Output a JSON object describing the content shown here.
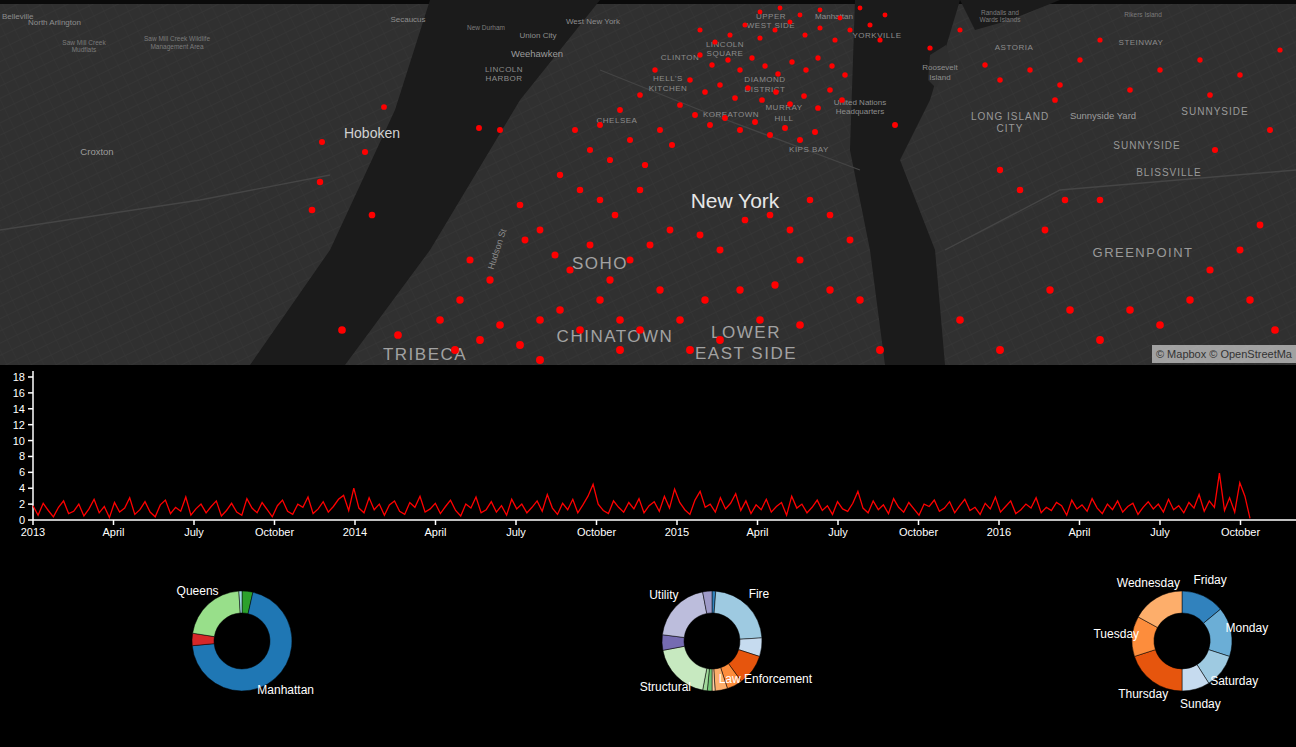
{
  "map": {
    "labels": [
      {
        "text": "Belleville"
      },
      {
        "text": "North Arlington"
      },
      {
        "text": "Secaucus"
      },
      {
        "text": "New Durham"
      },
      {
        "text": "West New York"
      },
      {
        "text": "Union City"
      },
      {
        "text": "Weehawken"
      },
      {
        "text": "LINCOLN"
      },
      {
        "text": "HARBOR"
      },
      {
        "text": "Saw Mill Creek"
      },
      {
        "text": "Mudflats"
      },
      {
        "text": "Saw Mill Creek Wildlife"
      },
      {
        "text": "Management Area"
      },
      {
        "text": "Hoboken"
      },
      {
        "text": "Croxton"
      },
      {
        "text": "CLINTON"
      },
      {
        "text": "HELL'S"
      },
      {
        "text": "KITCHEN"
      },
      {
        "text": "LINCOLN"
      },
      {
        "text": "SQUARE"
      },
      {
        "text": "UPPER"
      },
      {
        "text": "WEST SIDE"
      },
      {
        "text": "Manhattan"
      },
      {
        "text": "YORKVILLE"
      },
      {
        "text": "DIAMOND"
      },
      {
        "text": "DISTRICT"
      },
      {
        "text": "CHELSEA"
      },
      {
        "text": "KOREATOWN"
      },
      {
        "text": "MURRAY"
      },
      {
        "text": "HILL"
      },
      {
        "text": "United Nations"
      },
      {
        "text": "Headquarters"
      },
      {
        "text": "Roosevelt"
      },
      {
        "text": "Island"
      },
      {
        "text": "Randalls and"
      },
      {
        "text": "Wards Islands"
      },
      {
        "text": "Rikers Island"
      },
      {
        "text": "ASTORIA"
      },
      {
        "text": "STEINWAY"
      },
      {
        "text": "KIPS BAY"
      },
      {
        "text": "LONG ISLAND"
      },
      {
        "text": "CITY"
      },
      {
        "text": "Sunnyside Yard"
      },
      {
        "text": "SUNNYSIDE"
      },
      {
        "text": "SUNNYSIDE"
      },
      {
        "text": "BLISSVILLE"
      },
      {
        "text": "GREENPOINT"
      },
      {
        "text": "New York"
      },
      {
        "text": "SOHO"
      },
      {
        "text": "CHINATOWN"
      },
      {
        "text": "LOWER"
      },
      {
        "text": "EAST SIDE"
      },
      {
        "text": "TRIBECA"
      },
      {
        "text": "Hudson St"
      }
    ],
    "incidents": [
      [
        700,
        30
      ],
      [
        715,
        42
      ],
      [
        730,
        35
      ],
      [
        745,
        25
      ],
      [
        760,
        38
      ],
      [
        775,
        30
      ],
      [
        790,
        22
      ],
      [
        805,
        35
      ],
      [
        820,
        28
      ],
      [
        835,
        40
      ],
      [
        850,
        30
      ],
      [
        700,
        55
      ],
      [
        712,
        65
      ],
      [
        728,
        60
      ],
      [
        740,
        70
      ],
      [
        752,
        58
      ],
      [
        765,
        66
      ],
      [
        778,
        74
      ],
      [
        792,
        62
      ],
      [
        806,
        70
      ],
      [
        818,
        58
      ],
      [
        832,
        66
      ],
      [
        845,
        75
      ],
      [
        690,
        80
      ],
      [
        705,
        92
      ],
      [
        720,
        85
      ],
      [
        735,
        98
      ],
      [
        748,
        88
      ],
      [
        762,
        100
      ],
      [
        776,
        92
      ],
      [
        790,
        104
      ],
      [
        804,
        96
      ],
      [
        818,
        108
      ],
      [
        830,
        90
      ],
      [
        842,
        100
      ],
      [
        680,
        105
      ],
      [
        695,
        115
      ],
      [
        710,
        125
      ],
      [
        725,
        118
      ],
      [
        740,
        130
      ],
      [
        755,
        122
      ],
      [
        770,
        135
      ],
      [
        785,
        128
      ],
      [
        800,
        140
      ],
      [
        815,
        132
      ],
      [
        760,
        12
      ],
      [
        780,
        8
      ],
      [
        800,
        15
      ],
      [
        820,
        10
      ],
      [
        840,
        18
      ],
      [
        860,
        8
      ],
      [
        870,
        25
      ],
      [
        880,
        40
      ],
      [
        885,
        15
      ],
      [
        655,
        70
      ],
      [
        640,
        95
      ],
      [
        660,
        130
      ],
      [
        672,
        145
      ],
      [
        620,
        110
      ],
      [
        600,
        125
      ],
      [
        575,
        130
      ],
      [
        590,
        150
      ],
      [
        610,
        160
      ],
      [
        630,
        140
      ],
      [
        645,
        165
      ],
      [
        560,
        175
      ],
      [
        580,
        190
      ],
      [
        600,
        200
      ],
      [
        615,
        215
      ],
      [
        640,
        190
      ],
      [
        520,
        205
      ],
      [
        525,
        240
      ],
      [
        540,
        230
      ],
      [
        555,
        255
      ],
      [
        570,
        270
      ],
      [
        590,
        245
      ],
      [
        610,
        280
      ],
      [
        630,
        260
      ],
      [
        650,
        245
      ],
      [
        670,
        230
      ],
      [
        700,
        235
      ],
      [
        720,
        250
      ],
      [
        745,
        220
      ],
      [
        770,
        215
      ],
      [
        790,
        230
      ],
      [
        810,
        200
      ],
      [
        830,
        215
      ],
      [
        850,
        240
      ],
      [
        800,
        260
      ],
      [
        775,
        285
      ],
      [
        740,
        290
      ],
      [
        705,
        300
      ],
      [
        680,
        320
      ],
      [
        660,
        290
      ],
      [
        620,
        320
      ],
      [
        600,
        300
      ],
      [
        580,
        330
      ],
      [
        560,
        310
      ],
      [
        540,
        320
      ],
      [
        520,
        345
      ],
      [
        500,
        325
      ],
      [
        480,
        340
      ],
      [
        460,
        300
      ],
      [
        440,
        320
      ],
      [
        470,
        260
      ],
      [
        490,
        280
      ],
      [
        455,
        350
      ],
      [
        690,
        350
      ],
      [
        720,
        340
      ],
      [
        760,
        320
      ],
      [
        830,
        290
      ],
      [
        860,
        300
      ],
      [
        880,
        350
      ],
      [
        800,
        325
      ],
      [
        620,
        350
      ],
      [
        640,
        330
      ],
      [
        540,
        360
      ],
      [
        322,
        142
      ],
      [
        365,
        152
      ],
      [
        320,
        182
      ],
      [
        372,
        215
      ],
      [
        312,
        210
      ],
      [
        384,
        107
      ],
      [
        479,
        128
      ],
      [
        500,
        130
      ],
      [
        342,
        330
      ],
      [
        398,
        335
      ],
      [
        895,
        125
      ],
      [
        930,
        48
      ],
      [
        960,
        30
      ],
      [
        985,
        65
      ],
      [
        1000,
        80
      ],
      [
        1030,
        70
      ],
      [
        1060,
        85
      ],
      [
        1080,
        60
      ],
      [
        1100,
        40
      ],
      [
        1130,
        90
      ],
      [
        1160,
        70
      ],
      [
        1200,
        60
      ],
      [
        1240,
        75
      ],
      [
        1280,
        50
      ],
      [
        1210,
        95
      ],
      [
        1000,
        170
      ],
      [
        1020,
        190
      ],
      [
        1045,
        230
      ],
      [
        1050,
        290
      ],
      [
        1070,
        310
      ],
      [
        1100,
        340
      ],
      [
        1130,
        310
      ],
      [
        1160,
        325
      ],
      [
        1190,
        300
      ],
      [
        1210,
        270
      ],
      [
        1240,
        250
      ],
      [
        1260,
        225
      ],
      [
        1275,
        330
      ],
      [
        1250,
        300
      ],
      [
        1100,
        200
      ],
      [
        1215,
        150
      ],
      [
        1270,
        130
      ],
      [
        1000,
        350
      ],
      [
        960,
        320
      ],
      [
        1055,
        100
      ],
      [
        1065,
        200
      ]
    ],
    "attribution": "© Mapbox © OpenStreetMa"
  },
  "timeline": {
    "y_ticks": [
      "0",
      "2",
      "4",
      "6",
      "8",
      "10",
      "12",
      "14",
      "16",
      "18"
    ],
    "x_ticks": [
      "2013",
      "April",
      "July",
      "October",
      "2014",
      "April",
      "July",
      "October",
      "2015",
      "April",
      "July",
      "October",
      "2016",
      "April",
      "July",
      "October"
    ],
    "values": [
      1.8,
      0.6,
      2.1,
      1.2,
      0.4,
      1.6,
      2.4,
      0.8,
      1.1,
      2.0,
      0.5,
      1.4,
      2.6,
      0.9,
      1.7,
      0.3,
      2.2,
      1.0,
      1.5,
      2.8,
      0.7,
      1.3,
      2.3,
      1.0,
      0.4,
      1.9,
      2.5,
      0.8,
      1.6,
      1.1,
      2.9,
      0.6,
      1.4,
      2.0,
      0.9,
      1.7,
      2.4,
      0.5,
      1.2,
      2.1,
      1.0,
      0.6,
      2.7,
      1.5,
      0.9,
      2.2,
      1.3,
      0.4,
      1.8,
      2.5,
      1.1,
      0.7,
      2.0,
      1.6,
      2.9,
      0.8,
      1.4,
      2.3,
      1.0,
      1.7,
      2.6,
      3.1,
      1.2,
      4.0,
      1.5,
      0.9,
      2.8,
      1.3,
      2.0,
      0.6,
      1.9,
      2.4,
      1.1,
      0.7,
      2.2,
      1.6,
      3.0,
      1.0,
      1.4,
      2.1,
      0.8,
      1.7,
      2.5,
      1.2,
      0.5,
      2.0,
      1.5,
      2.9,
      0.9,
      1.3,
      2.3,
      1.0,
      1.8,
      0.6,
      2.6,
      1.4,
      2.0,
      0.9,
      1.6,
      2.4,
      1.1,
      3.2,
      1.5,
      0.7,
      2.1,
      1.3,
      2.6,
      0.9,
      1.9,
      3.0,
      4.5,
      2.0,
      1.2,
      0.8,
      2.4,
      1.6,
      1.0,
      2.2,
      1.4,
      2.7,
      0.9,
      1.8,
      2.3,
      1.1,
      3.0,
      1.5,
      3.9,
      2.2,
      1.3,
      0.7,
      2.5,
      3.6,
      1.6,
      2.0,
      1.0,
      2.8,
      1.4,
      2.1,
      3.3,
      1.2,
      2.4,
      0.8,
      1.9,
      1.3,
      2.6,
      1.0,
      1.7,
      2.2,
      0.6,
      3.0,
      1.5,
      2.0,
      0.9,
      1.6,
      2.5,
      1.2,
      1.8,
      0.7,
      2.3,
      1.4,
      1.1,
      2.1,
      3.6,
      1.5,
      0.9,
      2.4,
      1.3,
      1.9,
      0.8,
      2.7,
      1.6,
      1.0,
      2.2,
      1.4,
      0.6,
      2.0,
      1.7,
      2.5,
      1.1,
      1.5,
      2.3,
      0.9,
      1.8,
      2.6,
      1.2,
      1.6,
      0.7,
      2.1,
      1.4,
      2.9,
      1.0,
      1.7,
      2.4,
      0.8,
      1.3,
      2.0,
      1.5,
      2.8,
      0.9,
      1.6,
      1.2,
      2.2,
      1.8,
      0.6,
      2.5,
      1.4,
      1.9,
      1.1,
      2.7,
      1.5,
      0.8,
      2.0,
      1.3,
      2.4,
      1.0,
      1.7,
      2.1,
      0.7,
      1.6,
      2.3,
      1.4,
      2.0,
      1.0,
      2.6,
      1.3,
      1.8,
      0.9,
      2.2,
      1.5,
      3.2,
      1.1,
      2.4,
      1.6,
      5.9,
      1.2,
      2.8,
      1.0,
      4.7,
      3.0,
      0.2
    ]
  },
  "donuts": [
    {
      "slices": [
        {
          "value": 0.035,
          "color": "#2ca02c"
        },
        {
          "label": "Manhattan",
          "value": 0.7,
          "color": "#1f77b4"
        },
        {
          "value": 0.04,
          "color": "#d62728"
        },
        {
          "label": "Queens",
          "value": 0.215,
          "color": "#98df8a"
        },
        {
          "value": 0.01,
          "color": "#9edae5"
        }
      ]
    },
    {
      "slices": [
        {
          "value": 0.012,
          "color": "#3182bd"
        },
        {
          "label": "Fire",
          "value": 0.228,
          "color": "#9ecae1"
        },
        {
          "value": 0.06,
          "color": "#c6dbef"
        },
        {
          "label": "Law Enforcement",
          "value": 0.1,
          "color": "#e6550d"
        },
        {
          "value": 0.05,
          "color": "#fd8d3c"
        },
        {
          "value": 0.04,
          "color": "#fdae6b"
        },
        {
          "value": 0.01,
          "color": "#fdd0a2"
        },
        {
          "value": 0.015,
          "color": "#74c476"
        },
        {
          "value": 0.015,
          "color": "#a1d99b"
        },
        {
          "label": "Structural",
          "value": 0.19,
          "color": "#c7e9c0"
        },
        {
          "value": 0.05,
          "color": "#756bb1"
        },
        {
          "label": "Utility",
          "value": 0.2,
          "color": "#bcbddc"
        },
        {
          "value": 0.03,
          "color": "#9e9ac8"
        }
      ]
    },
    {
      "slices": [
        {
          "label": "Friday",
          "value": 0.14,
          "color": "#3182bd"
        },
        {
          "label": "Monday",
          "value": 0.16,
          "color": "#6baed6"
        },
        {
          "label": "Saturday",
          "value": 0.11,
          "color": "#9ecae1"
        },
        {
          "label": "Sunday",
          "value": 0.09,
          "color": "#c6dbef"
        },
        {
          "label": "Thursday",
          "value": 0.2,
          "color": "#e6550d"
        },
        {
          "label": "Tuesday",
          "value": 0.13,
          "color": "#fd8d3c"
        },
        {
          "label": "Wednesday",
          "value": 0.17,
          "color": "#fdae6b"
        }
      ]
    }
  ]
}
